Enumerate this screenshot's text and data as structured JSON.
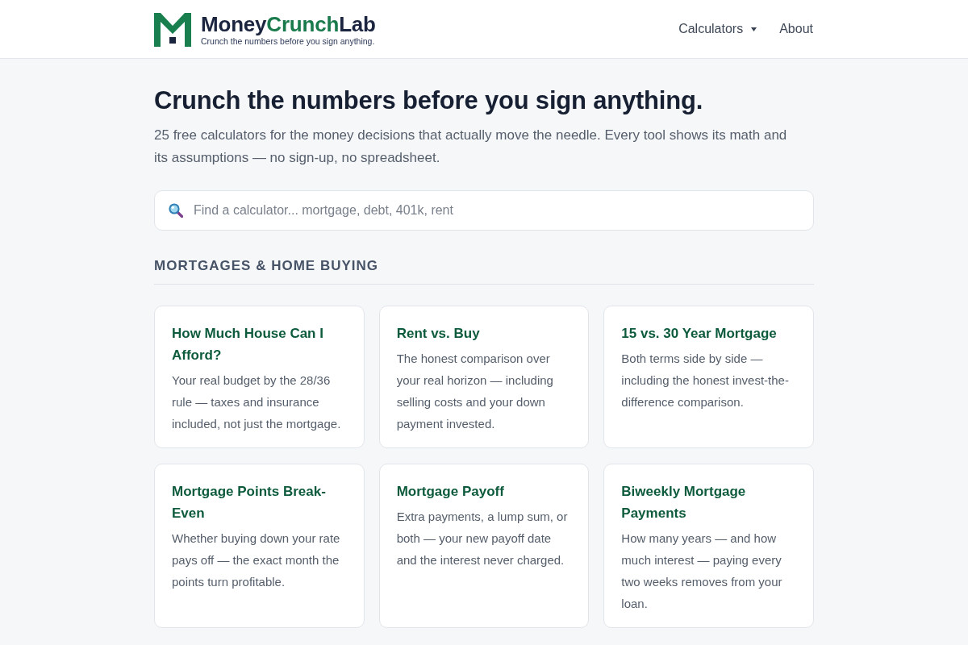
{
  "header": {
    "brand": [
      {
        "text": "Money",
        "color": "#1b2540"
      },
      {
        "text": "Crunch",
        "color": "#1a7a4c"
      },
      {
        "text": "Lab",
        "color": "#1b2540"
      }
    ],
    "tagline": "Crunch the numbers before you sign anything.",
    "nav": [
      {
        "label": "Calculators",
        "kind": "dropdown"
      },
      {
        "label": "About",
        "kind": "link"
      }
    ]
  },
  "hero": {
    "title": "Crunch the numbers before you sign anything.",
    "subtitle": "25 free calculators for the money decisions that actually move the needle. Every tool shows its math and its assumptions — no sign-up, no spreadsheet."
  },
  "search": {
    "placeholder": "Find a calculator... mortgage, debt, 401k, rent"
  },
  "sections": [
    {
      "heading": "MORTGAGES & HOME BUYING",
      "cards": [
        {
          "title": "How Much House Can I Afford?",
          "description": "Your real budget by the 28/36 rule — taxes and insurance included, not just the mortgage."
        },
        {
          "title": "Rent vs. Buy",
          "description": "The honest comparison over your real horizon — including selling costs and your down payment invested."
        },
        {
          "title": "15 vs. 30 Year Mortgage",
          "description": "Both terms side by side — including the honest invest-the-difference comparison."
        },
        {
          "title": "Mortgage Points Break-Even",
          "description": "Whether buying down your rate pays off — the exact month the points turn profitable."
        },
        {
          "title": "Mortgage Payoff",
          "description": "Extra payments, a lump sum, or both — your new payoff date and the interest never charged."
        },
        {
          "title": "Biweekly Mortgage Payments",
          "description": "How many years — and how much interest — paying every two weeks removes from your loan."
        }
      ]
    }
  ]
}
